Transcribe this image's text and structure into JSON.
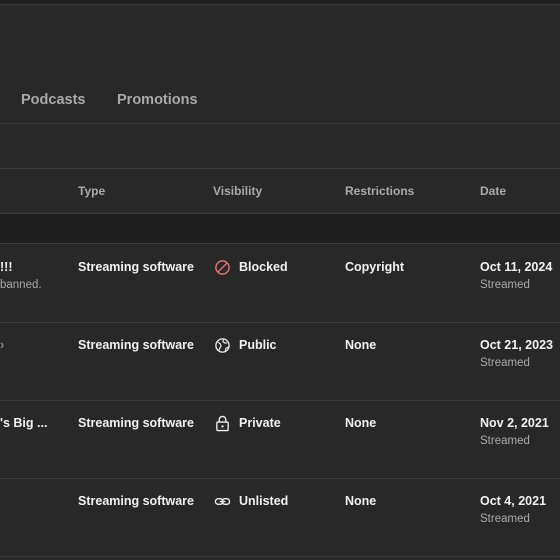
{
  "tabs": [
    {
      "label": "Podcasts"
    },
    {
      "label": "Promotions"
    }
  ],
  "table": {
    "headers": {
      "type": "Type",
      "visibility": "Visibility",
      "restrictions": "Restrictions",
      "date": "Date"
    },
    "rows": [
      {
        "title": "!!!",
        "subtitle": "banned.",
        "type": "Streaming software",
        "visibility": "Blocked",
        "visibility_icon": "blocked-icon",
        "restrictions": "Copyright",
        "date": "Oct 11, 2024",
        "date_status": "Streamed"
      },
      {
        "title": "",
        "subtitle": "",
        "type": "Streaming software",
        "visibility": "Public",
        "visibility_icon": "globe-icon",
        "restrictions": "None",
        "date": "Oct 21, 2023",
        "date_status": "Streamed"
      },
      {
        "title": "'s Big ...",
        "subtitle": "",
        "type": "Streaming software",
        "visibility": "Private",
        "visibility_icon": "lock-icon",
        "restrictions": "None",
        "date": "Nov 2, 2021",
        "date_status": "Streamed"
      },
      {
        "title": "",
        "subtitle": "",
        "type": "Streaming software",
        "visibility": "Unlisted",
        "visibility_icon": "link-icon",
        "restrictions": "None",
        "date": "Oct 4, 2021",
        "date_status": "Streamed"
      }
    ]
  },
  "colors": {
    "background": "#282828",
    "band": "#1f1f1f",
    "blocked_icon": "#e57373",
    "muted_text": "#aaaaaa"
  }
}
